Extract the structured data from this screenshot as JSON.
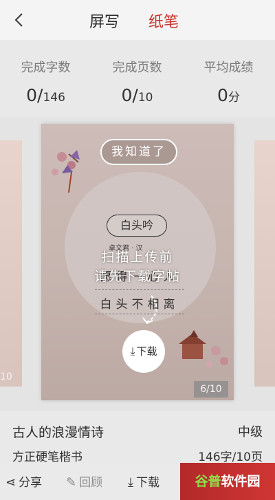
{
  "header": {
    "back_icon": "chevron-left-icon",
    "tabs": [
      {
        "label": "屏写",
        "active": false
      },
      {
        "label": "纸笔",
        "active": true,
        "color": "#c9302c"
      }
    ]
  },
  "stats": [
    {
      "label": "完成字数",
      "value": "0/",
      "total": "146"
    },
    {
      "label": "完成页数",
      "value": "0/",
      "total": "10"
    },
    {
      "label": "平均成绩",
      "value": "0",
      "unit": "分"
    }
  ],
  "carousel": {
    "left_page": "10",
    "main_card": {
      "got_it_label": "我知道了",
      "poem_title": "白头吟",
      "poem_author": "卓文君 · 汉",
      "poem_line1": "愿得一心人",
      "poem_line2": "白头不相离",
      "overlay_line1": "扫描上传前",
      "overlay_line2": "请先下载字帖",
      "download_label": "下载",
      "page_indicator": "6/10"
    }
  },
  "info": {
    "name": "古人的浪漫情诗",
    "level": "中级",
    "font": "方正硬笔楷书",
    "count": "146字/10页"
  },
  "bottom_bar": {
    "share_label": "分享",
    "review_label": "回顾",
    "download_label": "下载",
    "brand_part1": "谷普",
    "brand_part2": "软件园"
  }
}
